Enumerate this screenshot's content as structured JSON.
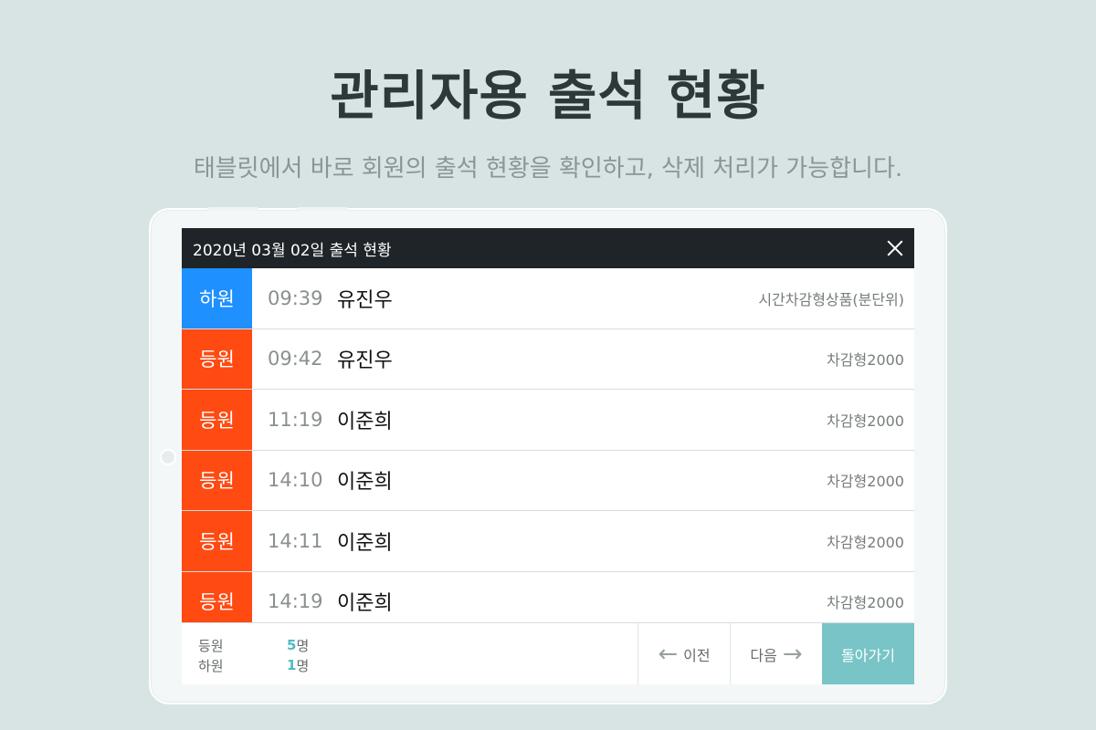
{
  "hero": {
    "title": "관리자용 출석 현황",
    "subtitle": "태블릿에서 바로 회원의 출석 현황을 확인하고, 삭제 처리가 가능합니다."
  },
  "dialog": {
    "title": "2020년 03월 02일 출석 현황",
    "rows": [
      {
        "status": "하원",
        "status_type": "out",
        "time": "09:39",
        "name": "유진우",
        "product": "시간차감형상품(분단위)"
      },
      {
        "status": "등원",
        "status_type": "in",
        "time": "09:42",
        "name": "유진우",
        "product": "차감형2000"
      },
      {
        "status": "등원",
        "status_type": "in",
        "time": "11:19",
        "name": "이준희",
        "product": "차감형2000"
      },
      {
        "status": "등원",
        "status_type": "in",
        "time": "14:10",
        "name": "이준희",
        "product": "차감형2000"
      },
      {
        "status": "등원",
        "status_type": "in",
        "time": "14:11",
        "name": "이준희",
        "product": "차감형2000"
      },
      {
        "status": "등원",
        "status_type": "in",
        "time": "14:19",
        "name": "이준희",
        "product": "차감형2000"
      }
    ],
    "summary": {
      "in_label": "등원",
      "in_count": "5",
      "in_unit": "명",
      "out_label": "하원",
      "out_count": "1",
      "out_unit": "명"
    },
    "prev_label": "이전",
    "next_label": "다음",
    "back_label": "돌아가기"
  },
  "colors": {
    "in_badge": "#ff4a12",
    "out_badge": "#1e90ff",
    "accent": "#78c4c6",
    "header_bg": "#1f2428"
  },
  "icons": {
    "close": "close-icon",
    "prev": "arrow-left-icon",
    "next": "arrow-right-icon"
  }
}
